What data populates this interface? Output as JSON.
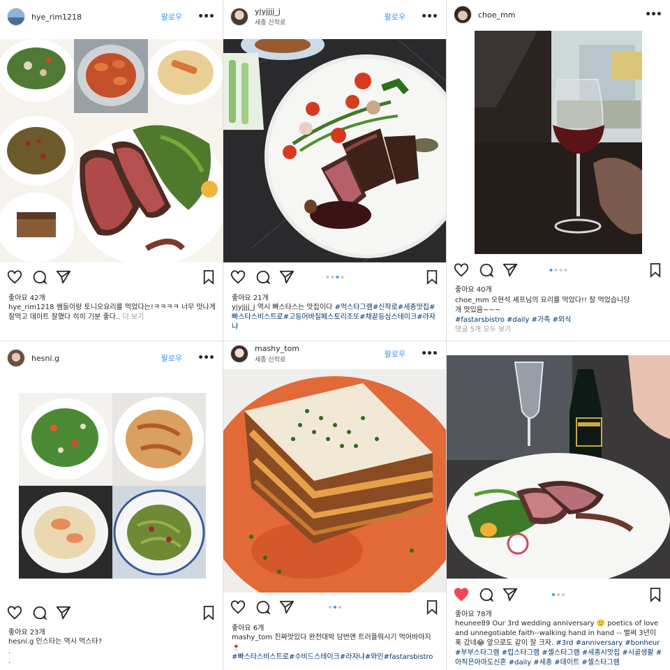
{
  "icons": {
    "heart": "heart-icon",
    "comment": "comment-icon",
    "share": "paper-plane-icon",
    "save": "bookmark-icon",
    "more": "more-options-icon"
  },
  "colors": {
    "link": "#3897f0",
    "hashtag": "#003569",
    "liked": "#ed4956"
  },
  "posts": [
    {
      "username": "hye_rim1218",
      "follow": "팔로우",
      "more": "•••",
      "likes": "좋아요 42개",
      "caption": "쌤들이랑 토니오요리를 먹었다는!ㅋㅋㅋㅋ 너무 맛나게 잘먹고 데이트 잘했다 히히 기분 좋다..",
      "more_link": "더 보기"
    },
    {
      "username": "yjyjjjj_j",
      "location": "세종 신작로",
      "follow": "팔로우",
      "more": "•••",
      "likes": "좋아요 21개",
      "caption": "역시 빠스타스는 맛집이다",
      "hashtags": "#먹스타그램#신작로#세종맛집#빠스타스비스트로#고등어바질페스토리조또#채끝등심스테이크#라자냐"
    },
    {
      "username": "choe_mm",
      "more": "•••",
      "likes": "좋아요 40개",
      "caption": "오현석 셰프님의 요리를 먹었다!! 잘 먹었습니당",
      "caption2": "개 멋있음~~~",
      "hashtags": "#fastarsbistro #daily #가족 #외식",
      "comments": "댓글 5개 모두 보기"
    },
    {
      "username": "hesni.g",
      "follow": "팔로우",
      "more": "•••",
      "likes": "좋아요 23개",
      "caption": "인스타는 역시 먹스타?",
      "extra1": ".",
      "extra2": "."
    },
    {
      "username": "mashy_tom",
      "location": "세종 신작로",
      "follow": "팔로우",
      "more": "•••",
      "likes": "좋아요 6개",
      "caption": "진짜맛있다 완전대박 담번엔 트러플뭐시기 먹어바야지🍷",
      "hashtags": "#빠스타스비스트로#수비드스테이크#라자냐#와인#fastarsbistro"
    },
    {
      "username": "heunee89",
      "likes": "좋아요 78개",
      "caption": "Our 3rd wedding anniversary 🙂 poetics of love and unnegotiable  faith--walking hand in hand -- 벌써 3년이 훅 갔네😂  앞으로도 같이 잘 크자.",
      "hashtags": "#3rd #anniversary #bonheur #부부스타그램 #럽스타그램 #셀스타그램 #세종시맛집 #시골생활 #아직은아마도신혼 #daily #세종 #데이트 #셀스타그램"
    }
  ]
}
